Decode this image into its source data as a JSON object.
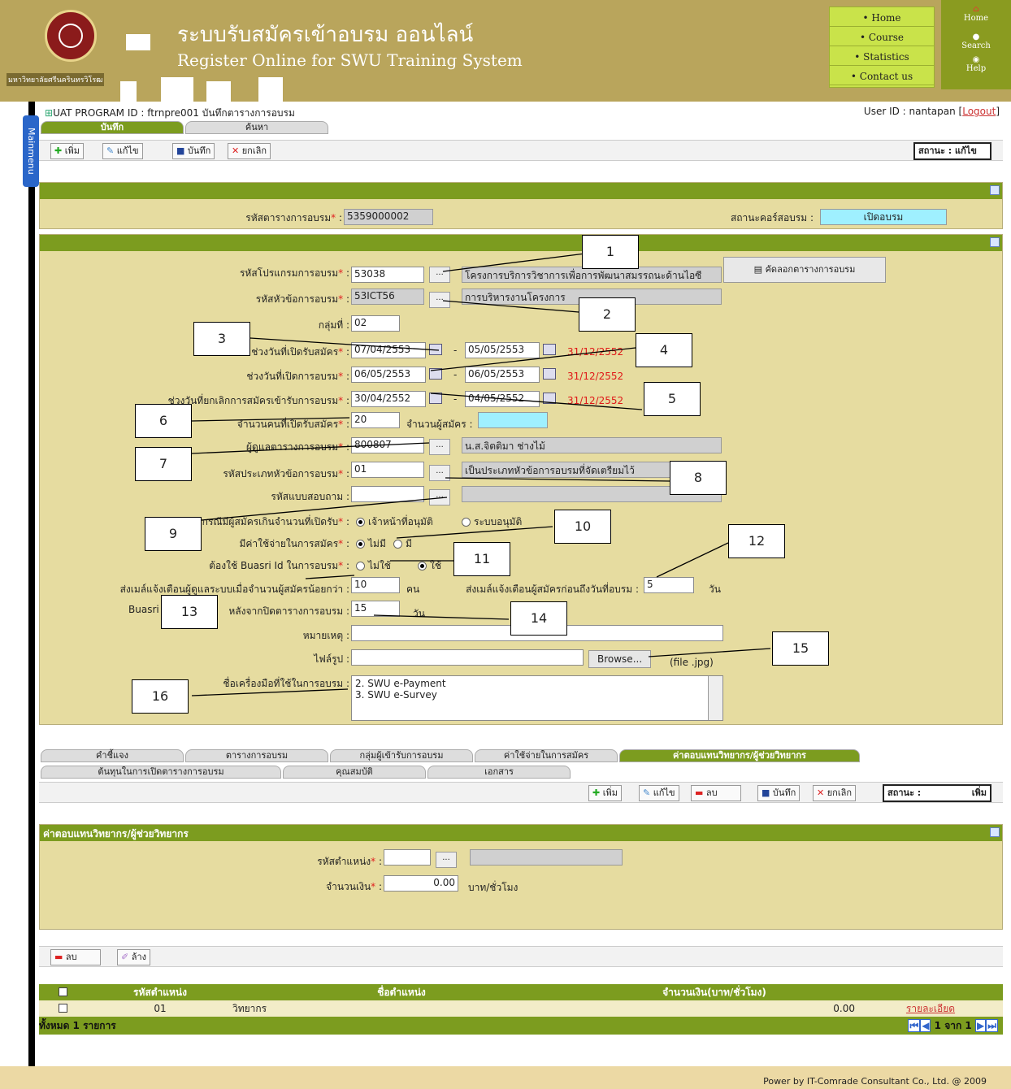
{
  "header": {
    "title_th": "ระบบรับสมัครเข้าอบรม ออนไลน์",
    "title_en": "Register Online for  SWU Training System",
    "university": "มหาวิทยาลัยศรีนครินทรวิโรฒ",
    "nav": [
      "• Home",
      "• Course",
      "• Statistics",
      "• Contact us"
    ],
    "side": {
      "home": "Home",
      "search": "Search",
      "help": "Help"
    }
  },
  "mainmenu": "Mainmenu",
  "program": {
    "text": "UAT   PROGRAM ID : ftrnpre001 บันทึกตารางการอบรม",
    "user": "User ID : nantapan [",
    "logout": "Logout",
    "close": "]"
  },
  "tabs_top": [
    "บันทึก",
    "ค้นหา"
  ],
  "toolbar1": {
    "add": "เพิ่ม",
    "edit": "แก้ไข",
    "save": "บันทึก",
    "cancel": "ยกเลิก",
    "status": "สถานะ : แก้ไข"
  },
  "p1": {
    "code_label": "รหัสตารางการอบรม",
    "code": "5359000002",
    "status_label": "สถานะคอร์สอบรม :",
    "status": "เปิดอบรม"
  },
  "form": {
    "program_label": "รหัสโปรแกรมการอบรม",
    "program_code": "53038",
    "program_name": "โครงการบริการวิชาการเพื่อการพัฒนาสมรรถนะด้านไอซี",
    "copy_btn": "คัดลอกตารางการอบรม",
    "topic_label": "รหัสหัวข้อการอบรม",
    "topic_code": "53ICT56",
    "topic_name": "การบริหารงานโครงการ",
    "group_label": "กลุ่มที่ :",
    "group": "02",
    "reg_label": "ช่วงวันที่เปิดรับสมัคร",
    "reg_from": "07/04/2553",
    "reg_to": "05/05/2553",
    "reg_red": "31/12/2552",
    "train_label": "ช่วงวันที่เปิดการอบรม",
    "train_from": "06/05/2553",
    "train_to": "06/05/2553",
    "train_red": "31/12/2552",
    "cancel_label": "ช่วงวันที่ยกเลิกการสมัครเข้ารับการอบรม",
    "cancel_from": "30/04/2552",
    "cancel_to": "04/05/2552",
    "cancel_red": "31/12/2552",
    "seats_label": "จำนวนคนที่เปิดรับสมัคร",
    "seats": "20",
    "applicants_label": "จำนวนผู้สมัคร :",
    "owner_label": "ผู้ดูแลตารางการอบรม",
    "owner_code": "800807",
    "owner_name": "น.ส.จิตติมา  ช่างไม้",
    "type_label": "รหัสประเภทหัวข้อการอบรม",
    "type_code": "01",
    "type_name": "เป็นประเภทหัวข้อการอบรมที่จัดเตรียมไว้",
    "survey_label": "รหัสแบบสอบถาม :",
    "over_label": "กรณีมีผู้สมัครเกินจำนวนที่เปิดรับ",
    "over_opt1": "เจ้าหน้าที่อนุมัติ",
    "over_opt2": "ระบบอนุมัติ",
    "fee_label": "มีค่าใช้จ่ายในการสมัคร",
    "fee_opt1": "ไม่มี",
    "fee_opt2": "มี",
    "buasri_label": "ต้องใช้ Buasri Id ในการอบรม",
    "buasri_opt1": "ไม่ใช้",
    "buasri_opt2": "ใช้",
    "mail_label": "ส่งเมล์แจ้งเตือนผู้ดูแลระบบเมื่อจำนวนผู้สมัครน้อยกว่า :",
    "mail_val": "10",
    "mail_unit": "คน",
    "mail2_label": "ส่งเมล์แจ้งเตือนผู้สมัครก่อนถึงวันที่อบรม :",
    "mail2_val": "5",
    "mail2_unit": "วัน",
    "buasri2_label": "Buasri",
    "buasri2_tail": "หลังจากปิดตารางการอบรม :",
    "buasri2_val": "15",
    "buasri2_unit": "วัน",
    "note_label": "หมายเหตุ :",
    "file_label": "ไฟล์รูป :",
    "browse": "Browse...",
    "file_hint": "(file .jpg)",
    "tools_label": "ชื่อเครื่องมือที่ใช้ในการอบรม :",
    "tools": [
      "2. SWU e-Payment",
      "3. SWU e-Survey"
    ]
  },
  "callouts": [
    "1",
    "2",
    "3",
    "4",
    "5",
    "6",
    "7",
    "8",
    "9",
    "10",
    "11",
    "12",
    "13",
    "14",
    "15",
    "16"
  ],
  "tabs_bottom_row1": [
    "คำชี้แจง",
    "ตารางการอบรม",
    "กลุ่มผู้เข้ารับการอบรม",
    "ค่าใช้จ่ายในการสมัคร",
    "ค่าตอบแทนวิทยากร/ผู้ช่วยวิทยากร"
  ],
  "tabs_bottom_row2": [
    "ต้นทุนในการเปิดตารางการอบรม",
    "คุณสมบัติ",
    "เอกสาร"
  ],
  "toolbar2": {
    "add": "เพิ่ม",
    "edit": "แก้ไข",
    "del": "ลบ",
    "save": "บันทึก",
    "cancel": "ยกเลิก",
    "status": "สถานะ :",
    "status_val": "เพิ่ม"
  },
  "p3": {
    "title": "ค่าตอบแทนวิทยากร/ผู้ช่วยวิทยากร",
    "pos_label": "รหัสตำแหน่ง",
    "amount_label": "จำนวนเงิน",
    "amount": "0.00",
    "unit": "บาท/ชั่วโมง"
  },
  "toolbar3": {
    "del": "ลบ",
    "clear": "ล้าง"
  },
  "table": {
    "headers": [
      "รหัสตำแหน่ง",
      "ชื่อตำแหน่ง",
      "จำนวนเงิน(บาท/ชั่วโมง)"
    ],
    "rows": [
      {
        "code": "01",
        "name": "วิทยากร",
        "amount": "0.00",
        "link": "รายละเอียด"
      }
    ],
    "total": "ทั้งหมด  1  รายการ",
    "pager": "1 จาก 1"
  },
  "footer": "Power by IT-Comrade Consultant Co., Ltd. @ 2009"
}
